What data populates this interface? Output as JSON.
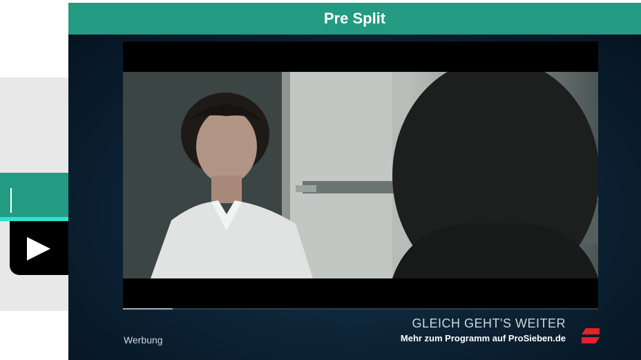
{
  "header": {
    "title": "Pre Split"
  },
  "player": {
    "ad_label": "Werbung",
    "continue_title": "GLEICH GEHT'S WEITER",
    "continue_subtitle": "Mehr zum Programm auf ProSieben.de",
    "progress": 0.104
  },
  "sidebar": {
    "play_icon": "play-icon"
  },
  "colors": {
    "accent": "#229b82",
    "highlight": "#2be3cf",
    "logo": "#e5202f"
  }
}
